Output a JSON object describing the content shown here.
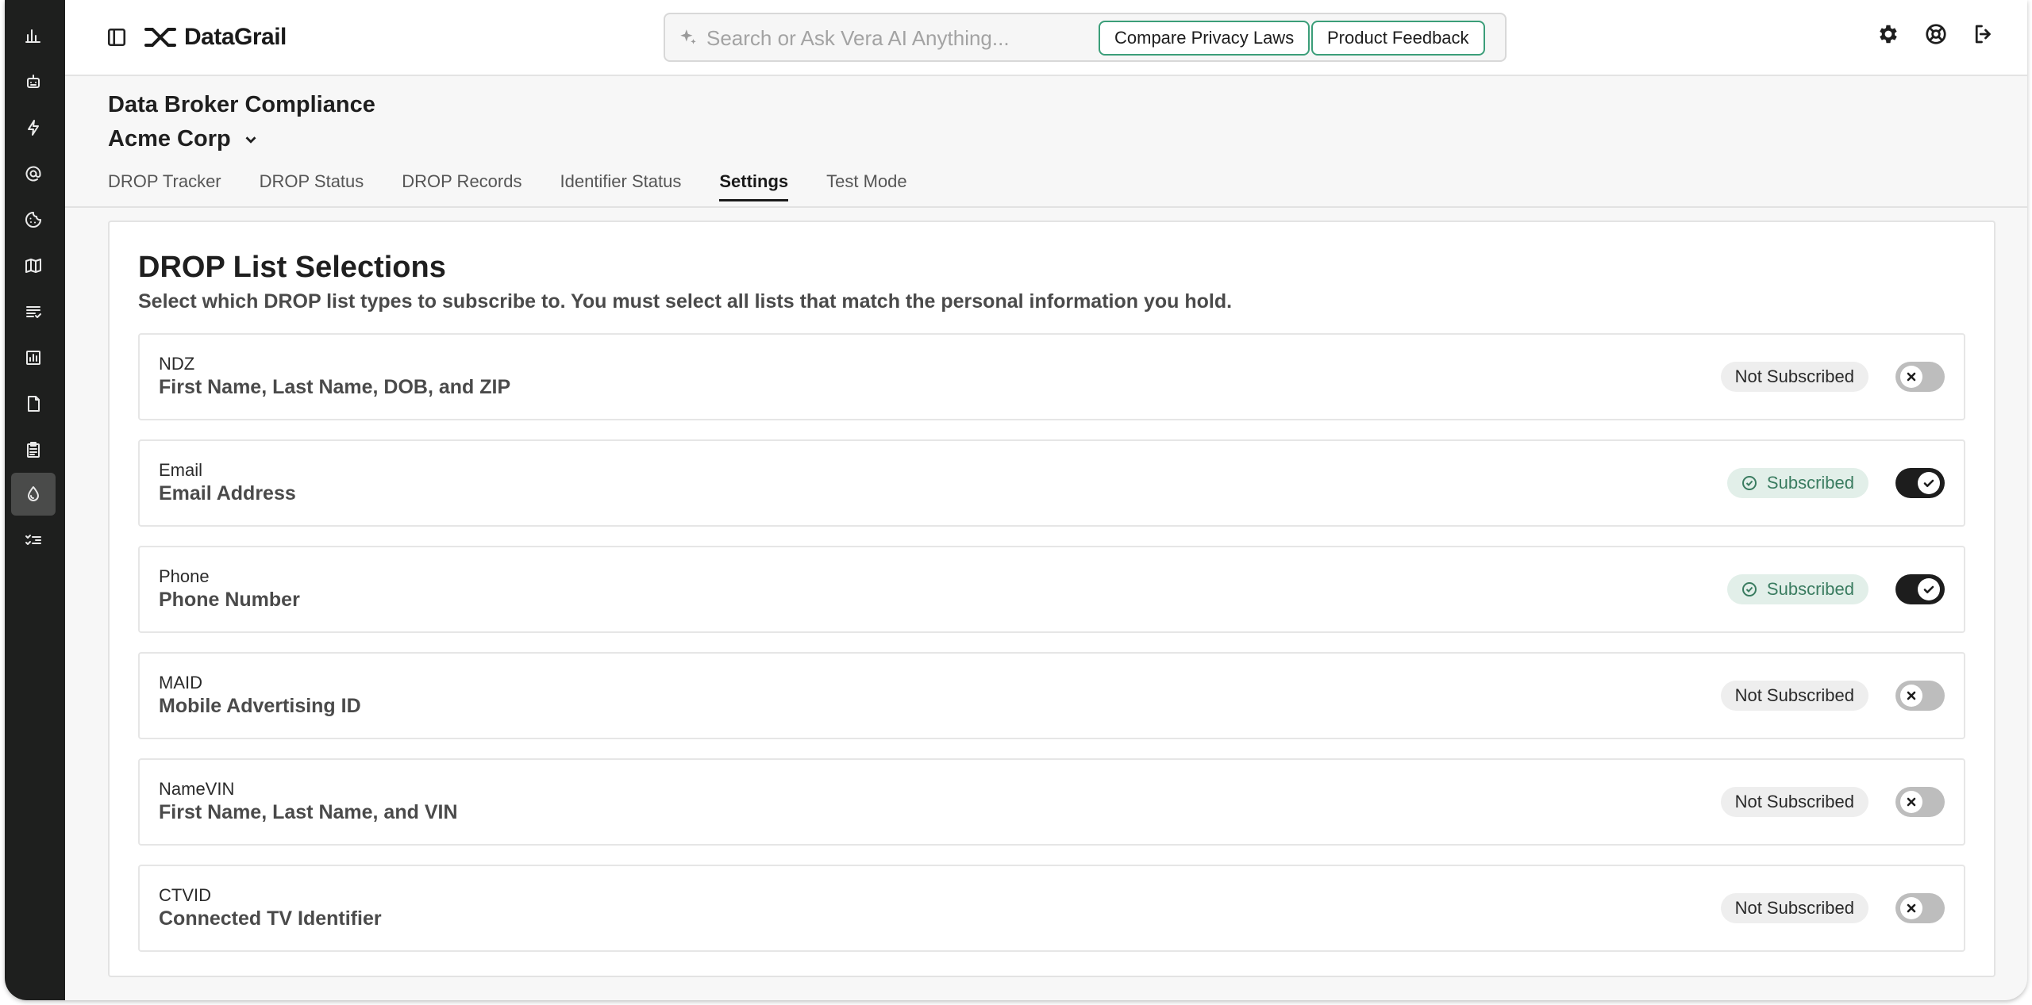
{
  "app": {
    "brand": "DataGrail"
  },
  "rail": {
    "items": [
      {
        "icon": "bar-chart-icon"
      },
      {
        "icon": "robot-icon"
      },
      {
        "icon": "lightning-icon"
      },
      {
        "icon": "at-sign-icon"
      },
      {
        "icon": "cookie-icon"
      },
      {
        "icon": "map-icon"
      },
      {
        "icon": "list-check-icon"
      },
      {
        "icon": "report-chart-icon"
      },
      {
        "icon": "document-icon"
      },
      {
        "icon": "clipboard-icon"
      },
      {
        "icon": "droplet-icon"
      },
      {
        "icon": "checklist-icon"
      }
    ],
    "active_index": 10
  },
  "search": {
    "placeholder": "Search or Ask Vera AI Anything..."
  },
  "topbar": {
    "compare_label": "Compare Privacy Laws",
    "feedback_label": "Product Feedback"
  },
  "header": {
    "title": "Data Broker Compliance",
    "org": "Acme Corp"
  },
  "tabs": [
    {
      "label": "DROP Tracker"
    },
    {
      "label": "DROP Status"
    },
    {
      "label": "DROP Records"
    },
    {
      "label": "Identifier Status"
    },
    {
      "label": "Settings"
    },
    {
      "label": "Test Mode"
    }
  ],
  "active_tab": "Settings",
  "card": {
    "title": "DROP List Selections",
    "subtitle": "Select which DROP list types to subscribe to. You must select all lists that match the personal information you hold.",
    "rows": [
      {
        "type": "NDZ",
        "description": "First Name, Last Name, DOB, and ZIP",
        "status": "Not Subscribed",
        "subscribed": false
      },
      {
        "type": "Email",
        "description": "Email Address",
        "status": "Subscribed",
        "subscribed": true
      },
      {
        "type": "Phone",
        "description": "Phone Number",
        "status": "Subscribed",
        "subscribed": true
      },
      {
        "type": "MAID",
        "description": "Mobile Advertising ID",
        "status": "Not Subscribed",
        "subscribed": false
      },
      {
        "type": "NameVIN",
        "description": "First Name, Last Name, and VIN",
        "status": "Not Subscribed",
        "subscribed": false
      },
      {
        "type": "CTVID",
        "description": "Connected TV Identifier",
        "status": "Not Subscribed",
        "subscribed": false
      }
    ]
  },
  "colors": {
    "accent_green": "#3b9e79",
    "subscribed_bg": "#e2efe9",
    "rail_bg": "#1e1f1e"
  }
}
